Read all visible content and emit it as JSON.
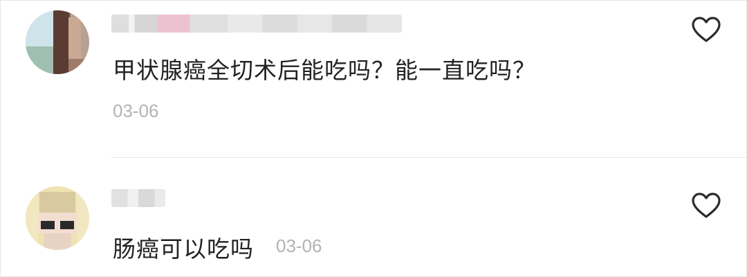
{
  "comments": [
    {
      "text": "甲状腺癌全切术后能吃吗？能一直吃吗？",
      "date": "03-06",
      "like_icon": "heart-outline-icon"
    },
    {
      "text": "肠癌可以吃吗",
      "date": "03-06",
      "like_icon": "heart-outline-icon"
    }
  ],
  "colors": {
    "text": "#222222",
    "meta": "#b3b3b3",
    "divider": "#e8e8e8",
    "icon": "#2b2b2b"
  }
}
